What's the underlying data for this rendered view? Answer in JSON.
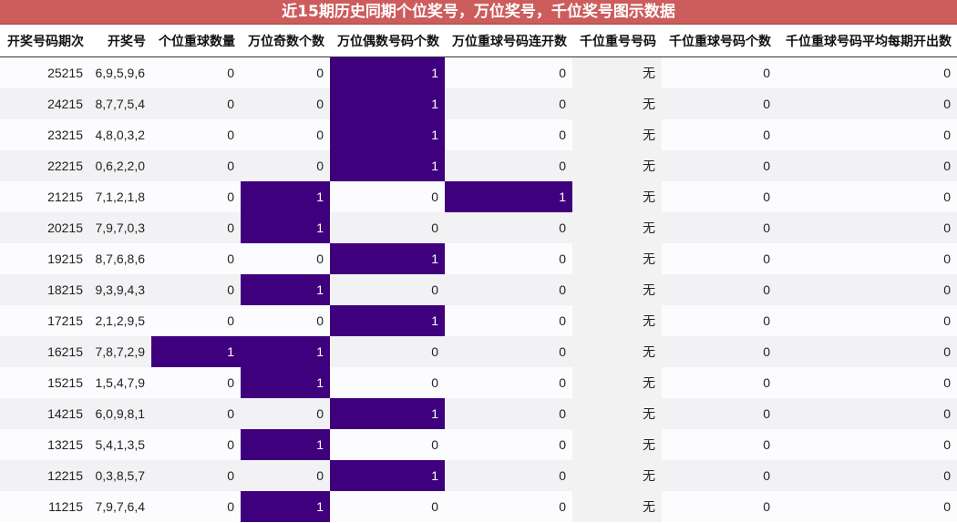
{
  "title": "近15期历史同期个位奖号，万位奖号，千位奖号图示数据",
  "colors": {
    "title_bg": "#cd5c5c",
    "highlight": "#3f007d"
  },
  "headers": [
    "开奖号码期次",
    "开奖号",
    "个位重球数量",
    "万位奇数个数",
    "万位偶数号码个数",
    "万位重球号码连开数",
    "千位重号号码",
    "千位重球号码个数",
    "千位重球号码平均每期开出数"
  ],
  "rows": [
    [
      "25215",
      "6,9,5,9,6",
      "0",
      "0",
      "1",
      "0",
      "无",
      "0",
      "0"
    ],
    [
      "24215",
      "8,7,7,5,4",
      "0",
      "0",
      "1",
      "0",
      "无",
      "0",
      "0"
    ],
    [
      "23215",
      "4,8,0,3,2",
      "0",
      "0",
      "1",
      "0",
      "无",
      "0",
      "0"
    ],
    [
      "22215",
      "0,6,2,2,0",
      "0",
      "0",
      "1",
      "0",
      "无",
      "0",
      "0"
    ],
    [
      "21215",
      "7,1,2,1,8",
      "0",
      "1",
      "0",
      "1",
      "无",
      "0",
      "0"
    ],
    [
      "20215",
      "7,9,7,0,3",
      "0",
      "1",
      "0",
      "0",
      "无",
      "0",
      "0"
    ],
    [
      "19215",
      "8,7,6,8,6",
      "0",
      "0",
      "1",
      "0",
      "无",
      "0",
      "0"
    ],
    [
      "18215",
      "9,3,9,4,3",
      "0",
      "1",
      "0",
      "0",
      "无",
      "0",
      "0"
    ],
    [
      "17215",
      "2,1,2,9,5",
      "0",
      "0",
      "1",
      "0",
      "无",
      "0",
      "0"
    ],
    [
      "16215",
      "7,8,7,2,9",
      "1",
      "1",
      "0",
      "0",
      "无",
      "0",
      "0"
    ],
    [
      "15215",
      "1,5,4,7,9",
      "0",
      "1",
      "0",
      "0",
      "无",
      "0",
      "0"
    ],
    [
      "14215",
      "6,0,9,8,1",
      "0",
      "0",
      "1",
      "0",
      "无",
      "0",
      "0"
    ],
    [
      "13215",
      "5,4,1,3,5",
      "0",
      "1",
      "0",
      "0",
      "无",
      "0",
      "0"
    ],
    [
      "12215",
      "0,3,8,5,7",
      "0",
      "0",
      "1",
      "0",
      "无",
      "0",
      "0"
    ],
    [
      "11215",
      "7,9,7,6,4",
      "0",
      "1",
      "0",
      "0",
      "无",
      "0",
      "0"
    ]
  ]
}
